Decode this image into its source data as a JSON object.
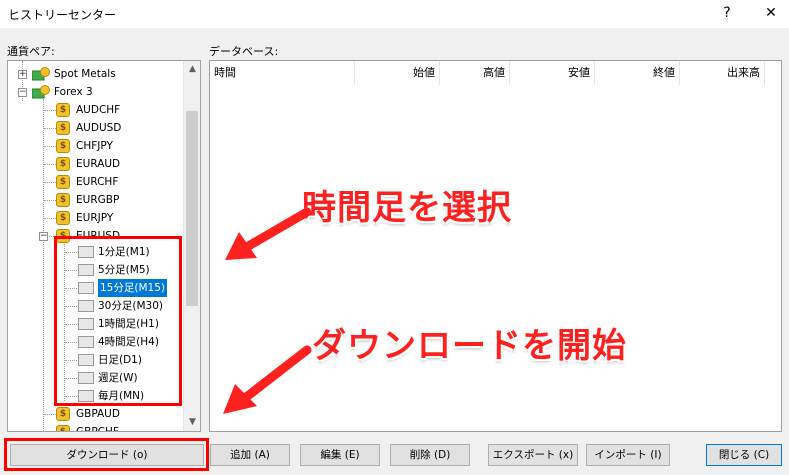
{
  "window": {
    "title": "ヒストリーセンター",
    "help_label": "?",
    "close_label": "✕"
  },
  "labels": {
    "pairs": "通貨ペア:",
    "database": "データベース:"
  },
  "tree": {
    "groups": [
      {
        "label": "Spot Metals",
        "expander": "+"
      },
      {
        "label": "Forex 3",
        "expander": "−"
      }
    ],
    "symbols": [
      "AUDCHF",
      "AUDUSD",
      "CHFJPY",
      "EURAUD",
      "EURCHF",
      "EURGBP",
      "EURJPY",
      "EURUSD"
    ],
    "eurusd_expander": "−",
    "periods": [
      "1分足(M1)",
      "5分足(M5)",
      "15分足(M15)",
      "30分足(M30)",
      "1時間足(H1)",
      "4時間足(H4)",
      "日足(D1)",
      "週足(W)",
      "毎月(MN)"
    ],
    "selected_period": "15分足(M15)",
    "more_symbols": [
      "GBPAUD",
      "GBPCHF"
    ],
    "coin_glyph": "$",
    "icons": {
      "group": "folder-coins-icon",
      "symbol": "coin-icon",
      "period": "timeframe-icon"
    }
  },
  "table": {
    "columns": [
      "時間",
      "始値",
      "高値",
      "安値",
      "終値",
      "出来高"
    ]
  },
  "buttons": {
    "download": "ダウンロード (o)",
    "add": "追加 (A)",
    "edit": "編集 (E)",
    "delete": "削除 (D)",
    "export": "エクスポート (x)",
    "import": "インポート (I)",
    "close": "閉じる (C)"
  },
  "annotations": {
    "select_timeframe": "時間足を選択",
    "start_download": "ダウンロードを開始"
  },
  "colors": {
    "accent": "#0078d7",
    "annotation": "#ff2020"
  }
}
